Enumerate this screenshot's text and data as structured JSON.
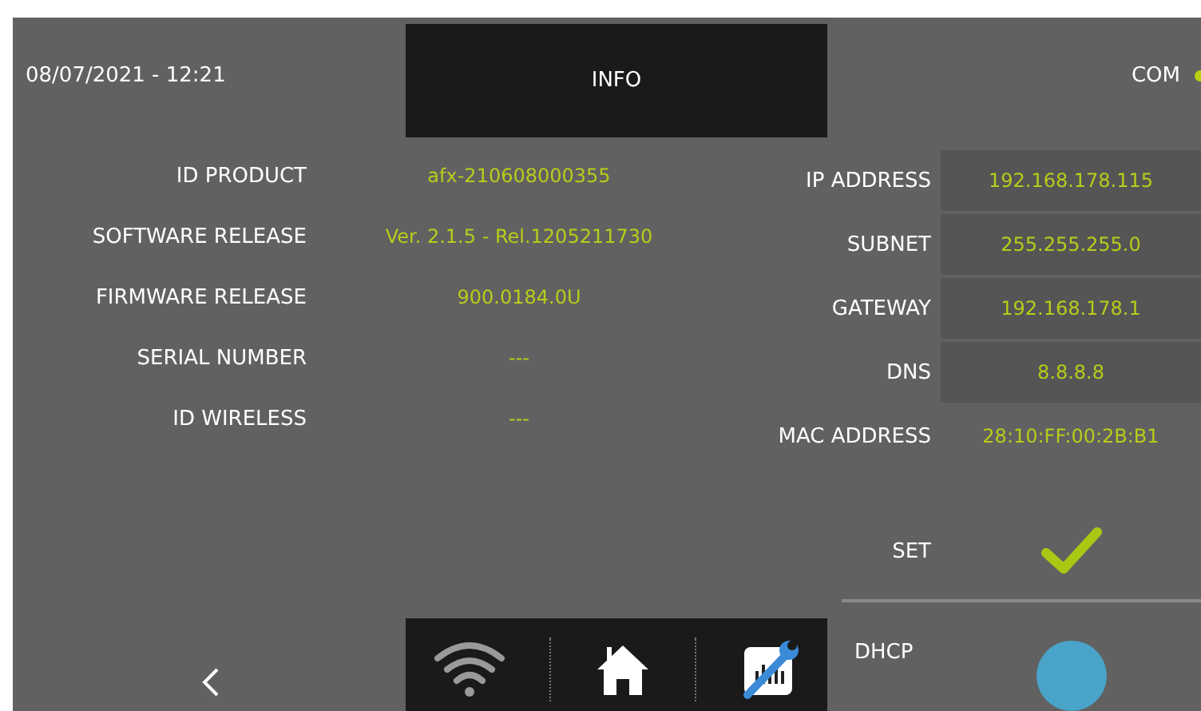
{
  "header": {
    "datetime": "08/07/2021 - 12:21",
    "title": "INFO",
    "com_label": "COM"
  },
  "product_info": [
    {
      "label": "ID PRODUCT",
      "value": "afx-210608000355"
    },
    {
      "label": "SOFTWARE RELEASE",
      "value": "Ver. 2.1.5 - Rel.1205211730"
    },
    {
      "label": "FIRMWARE RELEASE",
      "value": "900.0184.0U"
    },
    {
      "label": "SERIAL NUMBER",
      "value": "---"
    },
    {
      "label": "ID WIRELESS",
      "value": "---"
    }
  ],
  "network": [
    {
      "label": "IP ADDRESS",
      "value": "192.168.178.115",
      "boxed": true
    },
    {
      "label": "SUBNET",
      "value": "255.255.255.0",
      "boxed": true
    },
    {
      "label": "GATEWAY",
      "value": "192.168.178.1",
      "boxed": true
    },
    {
      "label": "DNS",
      "value": "8.8.8.8",
      "boxed": true
    },
    {
      "label": "MAC ADDRESS",
      "value": "28:10:FF:00:2B:B1",
      "boxed": false
    }
  ],
  "set_label": "SET",
  "dhcp_label": "DHCP",
  "nav": [
    {
      "kind": "wifi"
    },
    {
      "kind": "home"
    },
    {
      "kind": "network-settings"
    }
  ]
}
